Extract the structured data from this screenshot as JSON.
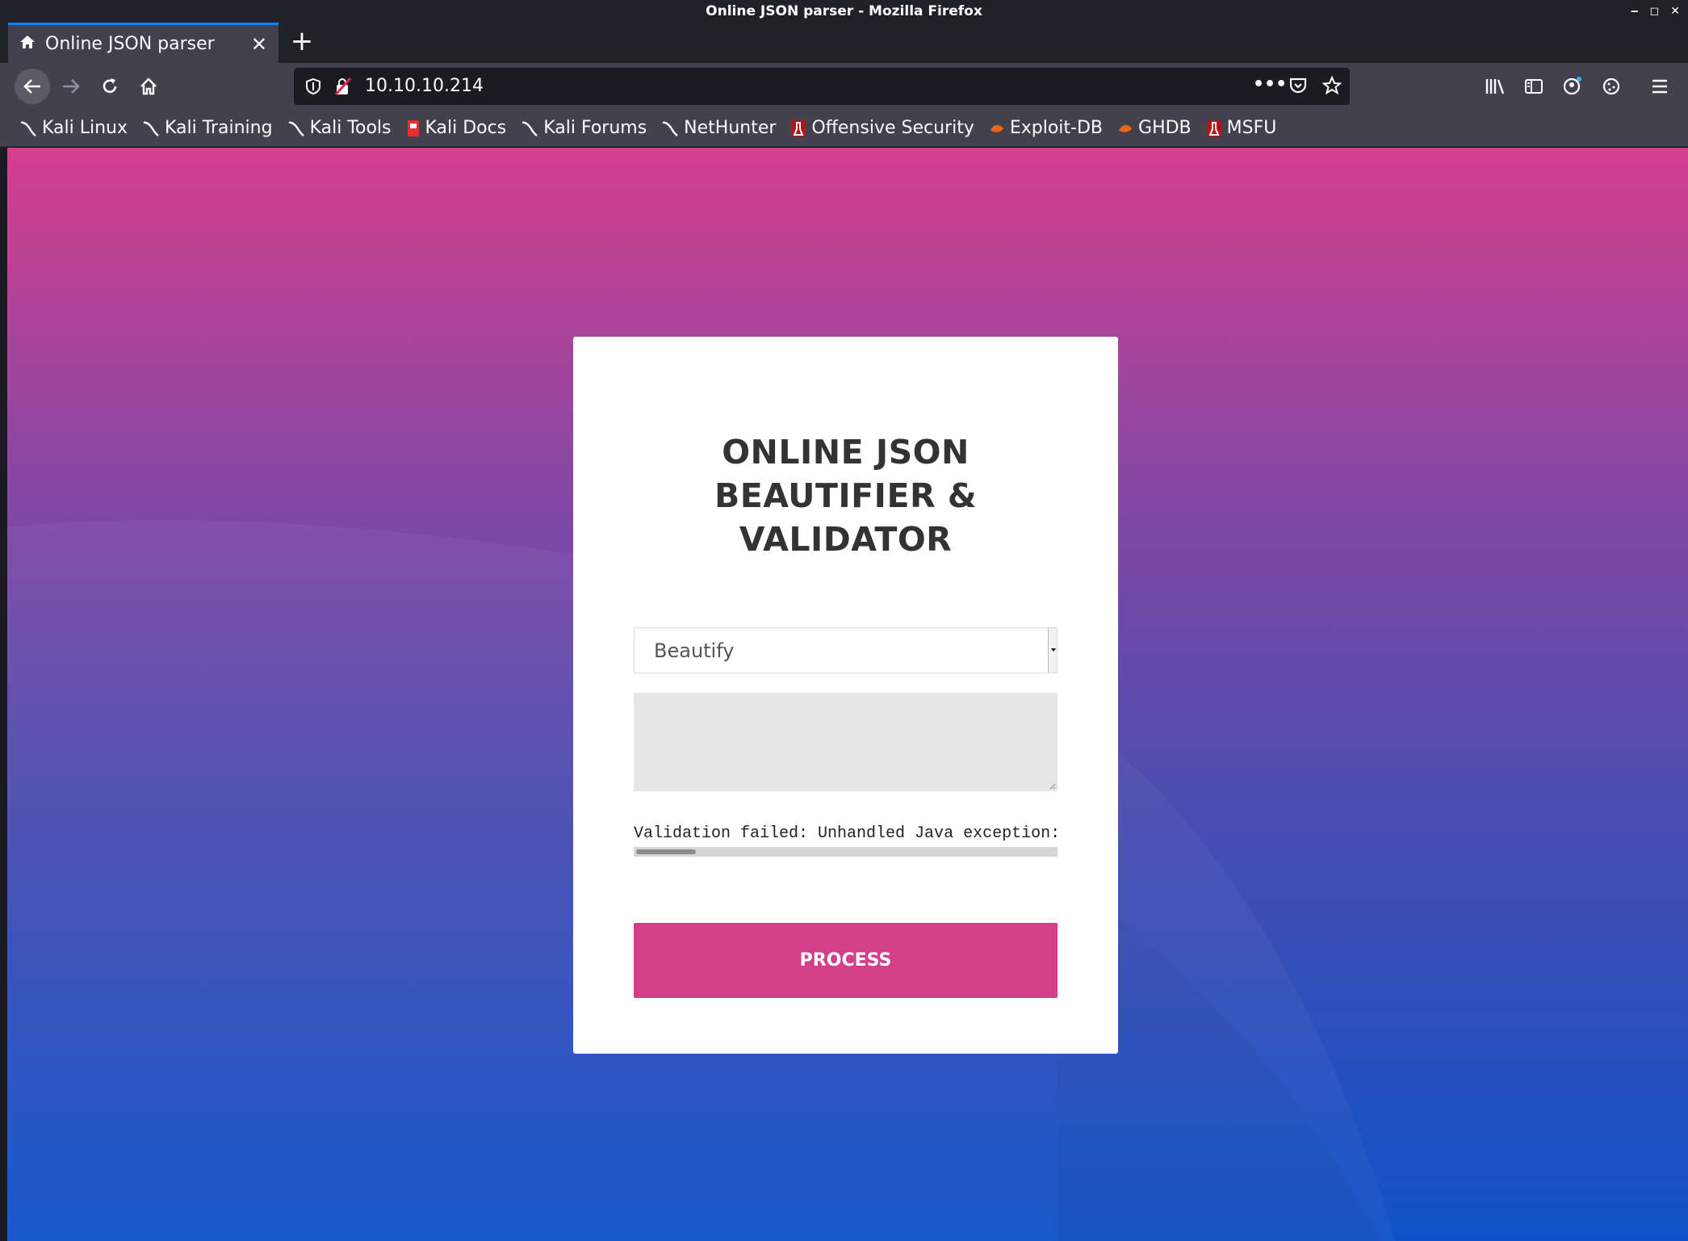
{
  "window": {
    "title": "Online JSON parser - Mozilla Firefox"
  },
  "tab": {
    "title": "Online JSON parser"
  },
  "urlbar": {
    "url": "10.10.10.214"
  },
  "bookmarks": [
    {
      "label": "Kali Linux",
      "icon": "kali-dragon-icon"
    },
    {
      "label": "Kali Training",
      "icon": "kali-dragon-icon"
    },
    {
      "label": "Kali Tools",
      "icon": "kali-dragon-icon"
    },
    {
      "label": "Kali Docs",
      "icon": "kali-docs-icon"
    },
    {
      "label": "Kali Forums",
      "icon": "kali-dragon-icon"
    },
    {
      "label": "NetHunter",
      "icon": "kali-dragon-icon"
    },
    {
      "label": "Offensive Security",
      "icon": "offsec-icon"
    },
    {
      "label": "Exploit-DB",
      "icon": "exploitdb-icon"
    },
    {
      "label": "GHDB",
      "icon": "exploitdb-icon"
    },
    {
      "label": "MSFU",
      "icon": "offsec-icon"
    }
  ],
  "page": {
    "title": "ONLINE JSON BEAUTIFIER & VALIDATOR",
    "select_value": "Beautify",
    "textarea_value": "",
    "result": "Validation failed: Unhandled Java exception:",
    "process_label": "PROCESS"
  },
  "colors": {
    "accent": "#d33f8b",
    "gradient_top": "#d43f8d",
    "gradient_bottom": "#0e52c8"
  }
}
